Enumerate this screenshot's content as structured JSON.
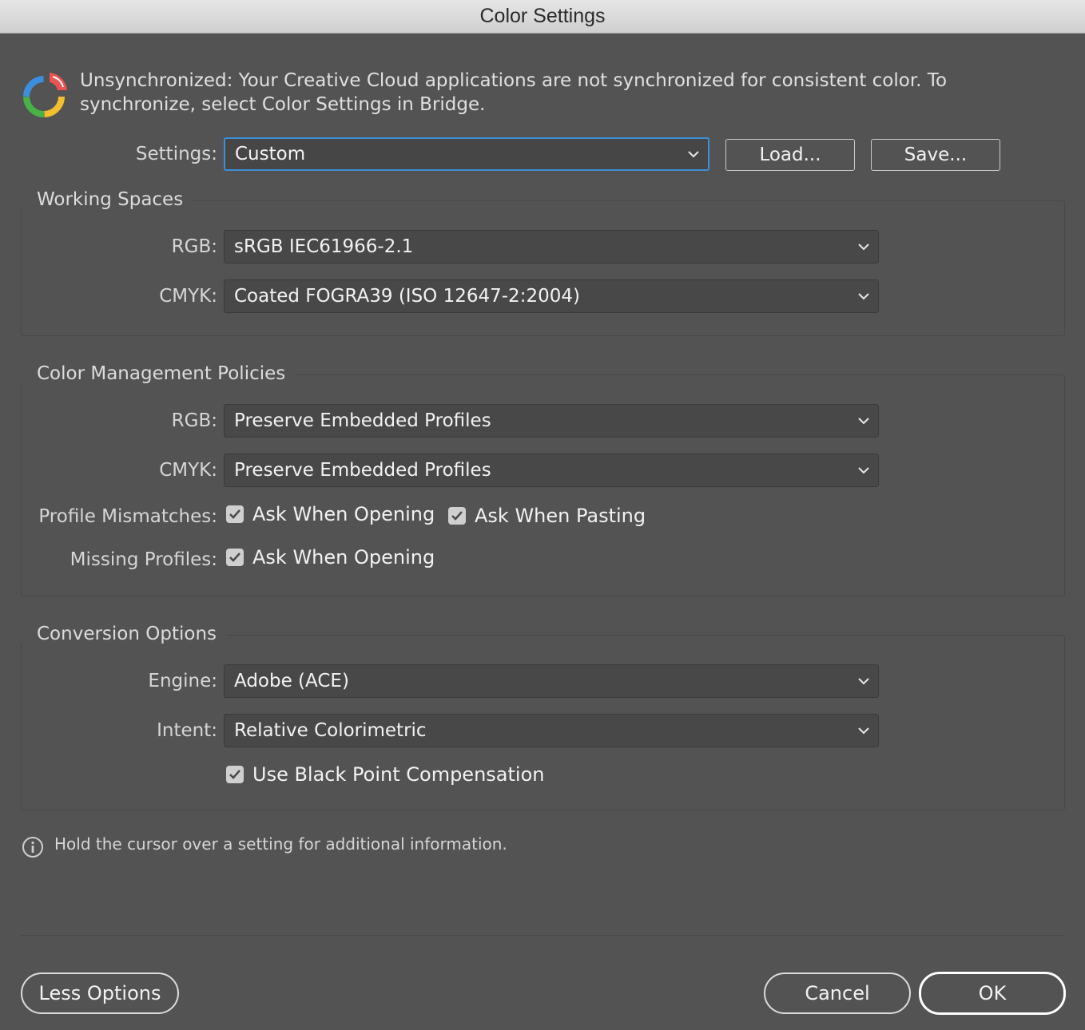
{
  "window": {
    "title": "Color Settings"
  },
  "sync": {
    "icon": "color-sync-icon",
    "message": "Unsynchronized: Your Creative Cloud applications are not synchronized for consistent color. To synchronize, select Color Settings in Bridge."
  },
  "settings": {
    "label": "Settings:",
    "value": "Custom",
    "load_label": "Load...",
    "save_label": "Save..."
  },
  "working_spaces": {
    "title": "Working Spaces",
    "rgb_label": "RGB:",
    "rgb_value": "sRGB IEC61966-2.1",
    "cmyk_label": "CMYK:",
    "cmyk_value": "Coated FOGRA39 (ISO 12647-2:2004)"
  },
  "policies": {
    "title": "Color Management Policies",
    "rgb_label": "RGB:",
    "rgb_value": "Preserve Embedded Profiles",
    "cmyk_label": "CMYK:",
    "cmyk_value": "Preserve Embedded Profiles",
    "mismatch_label": "Profile Mismatches:",
    "mismatch_opening": {
      "label": "Ask When Opening",
      "checked": true
    },
    "mismatch_pasting": {
      "label": "Ask When Pasting",
      "checked": true
    },
    "missing_label": "Missing Profiles:",
    "missing_opening": {
      "label": "Ask When Opening",
      "checked": true
    }
  },
  "conversion": {
    "title": "Conversion Options",
    "engine_label": "Engine:",
    "engine_value": "Adobe (ACE)",
    "intent_label": "Intent:",
    "intent_value": "Relative Colorimetric",
    "bpc": {
      "label": "Use Black Point Compensation",
      "checked": true
    }
  },
  "info": {
    "icon": "info-icon",
    "text": "Hold the cursor over a setting for additional information."
  },
  "footer": {
    "less_options_label": "Less Options",
    "cancel_label": "Cancel",
    "ok_label": "OK"
  },
  "colors": {
    "dialog_bg": "#535353",
    "focus_ring": "#3d8fd6",
    "field_bg": "#484848"
  }
}
